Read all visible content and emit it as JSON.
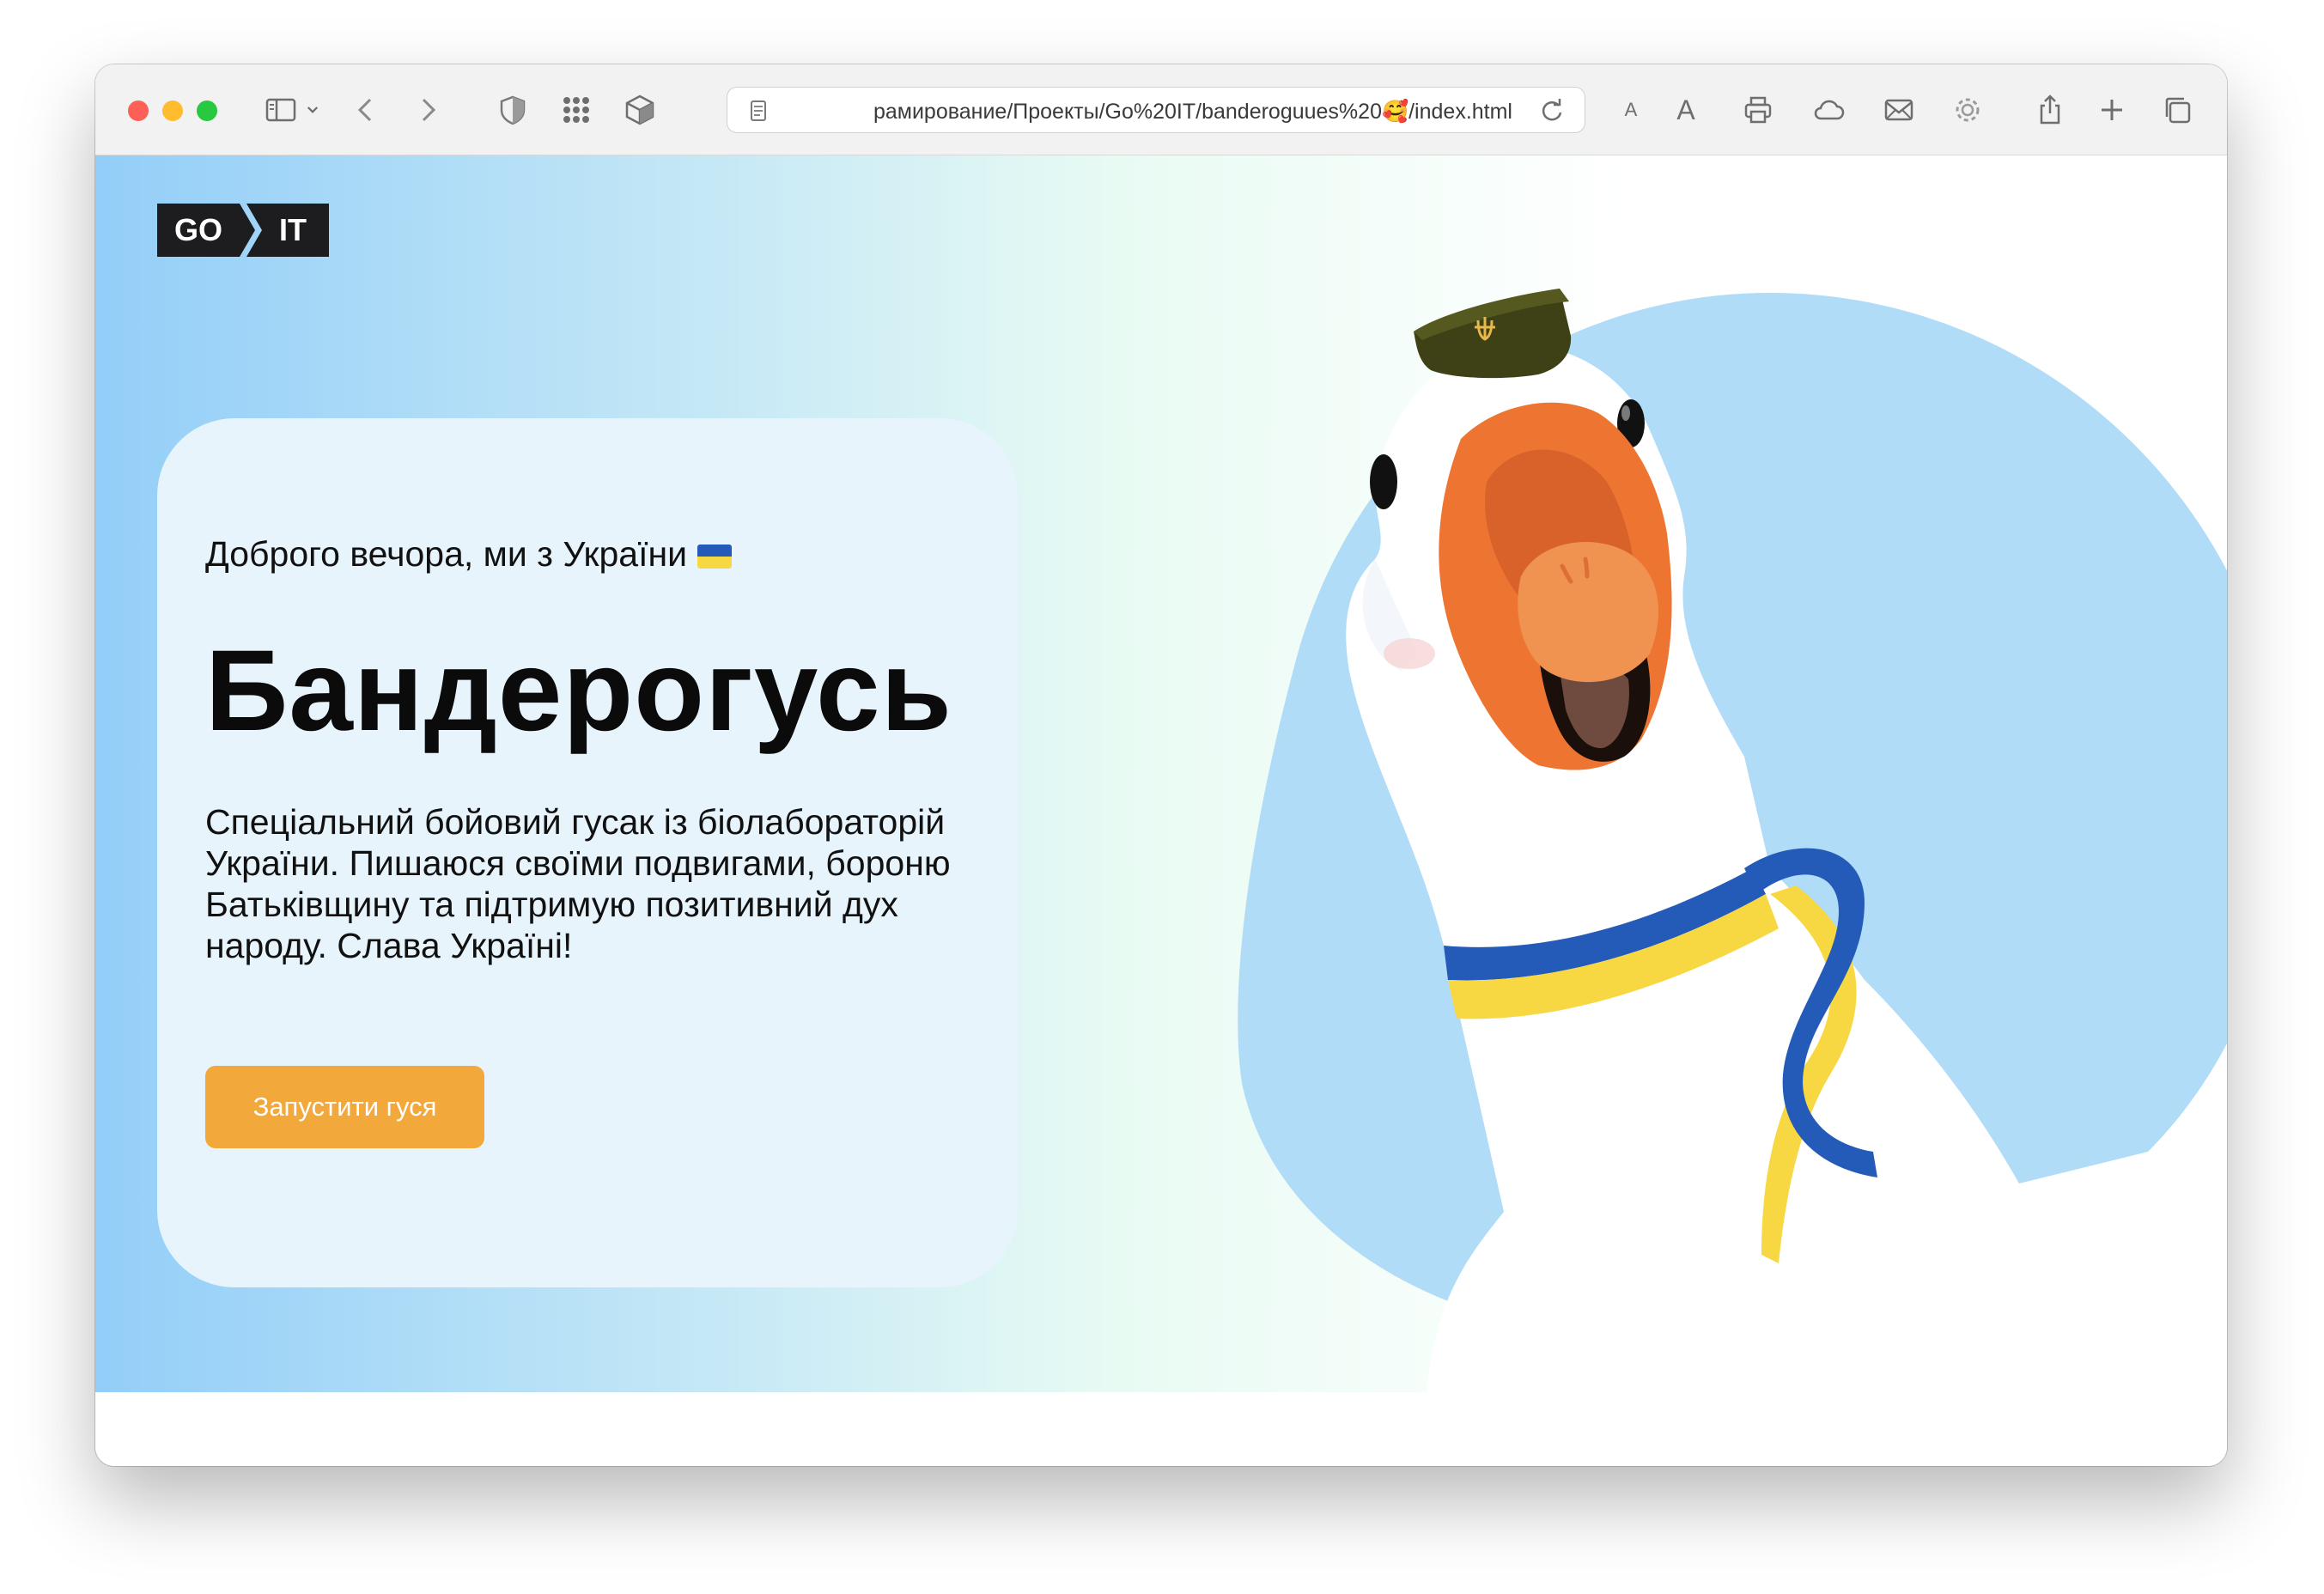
{
  "browser": {
    "url_display": "рамирование/Проекты/Go%20IT/banderoguues%20🥰/index.html",
    "text_smaller": "A",
    "text_larger": "A"
  },
  "logo": {
    "left": "GO",
    "right": "IT"
  },
  "hero": {
    "greeting": "Доброго вечора, ми з України",
    "title": "Бандерогусь",
    "description": "Спеціальний бойовий гусак із біолабораторій України. Пишаюся своїми подвигами, бороню Батьківщину та підтримую позитивний дух народу. Слава Україні!",
    "button_label": "Запустити гуся"
  },
  "colors": {
    "accent_button": "#f2a83a",
    "hero_blue": "#93cef8",
    "goose_circle": "#b0dcf8",
    "flag_blue": "#245bb8",
    "flag_yellow": "#f7d843"
  }
}
